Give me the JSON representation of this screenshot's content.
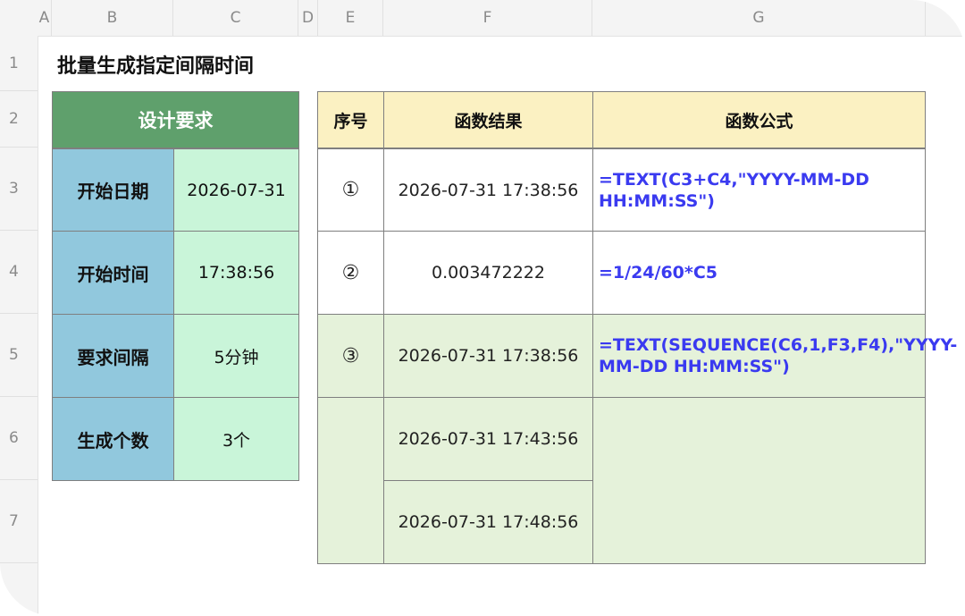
{
  "columns": [
    "A",
    "B",
    "C",
    "D",
    "E",
    "F",
    "G"
  ],
  "rows": [
    "1",
    "2",
    "3",
    "4",
    "5",
    "6",
    "7"
  ],
  "title": "批量生成指定间隔时间",
  "requirements": {
    "header": "设计要求",
    "items": [
      {
        "label": "开始日期",
        "value": "2026-07-31"
      },
      {
        "label": "开始时间",
        "value": "17:38:56"
      },
      {
        "label": "要求间隔",
        "value": "5分钟"
      },
      {
        "label": "生成个数",
        "value": "3个"
      }
    ]
  },
  "results": {
    "headers": [
      "序号",
      "函数结果",
      "函数公式"
    ],
    "rows": [
      {
        "no": "①",
        "result": "2026-07-31 17:38:56",
        "formula": "=TEXT(C3+C4,\"YYYY-MM-DD HH:MM:SS\")"
      },
      {
        "no": "②",
        "result": "0.003472222",
        "formula": "=1/24/60*C5"
      },
      {
        "no": "③",
        "result": "2026-07-31 17:38:56",
        "formula": "=TEXT(SEQUENCE(C6,1,F3,F4),\"YYYY-MM-DD HH:MM:SS\")"
      }
    ],
    "spill": [
      "2026-07-31 17:43:56",
      "2026-07-31 17:48:56"
    ]
  }
}
